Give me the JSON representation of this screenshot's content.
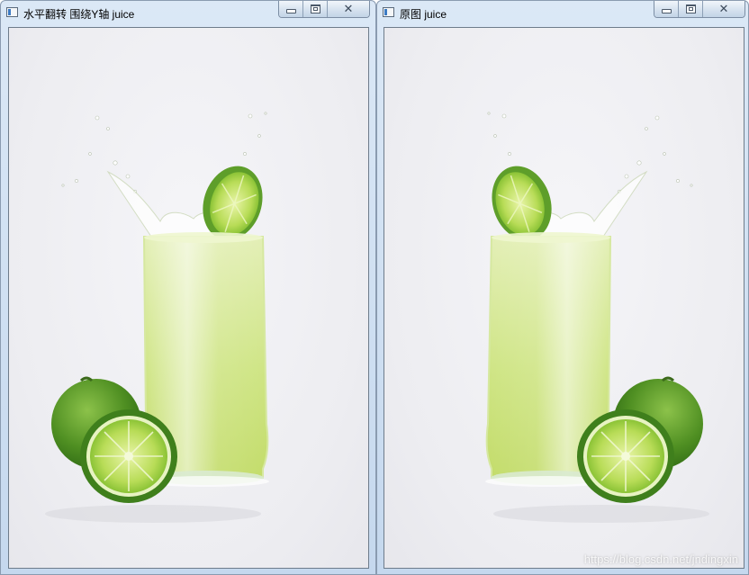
{
  "windows": [
    {
      "title": "水平翻转 围绕Y轴 juice"
    },
    {
      "title": "原图 juice"
    }
  ],
  "caption_buttons": {
    "minimize": "minimize",
    "maximize": "maximize",
    "close": "close"
  },
  "watermark": "https://blog.csdn.net/jndingxin",
  "colors": {
    "juice": "#c9e27a",
    "lime": "#5e9e2a",
    "background": "#eeeef2",
    "titlebar": "#cfe0f2"
  }
}
